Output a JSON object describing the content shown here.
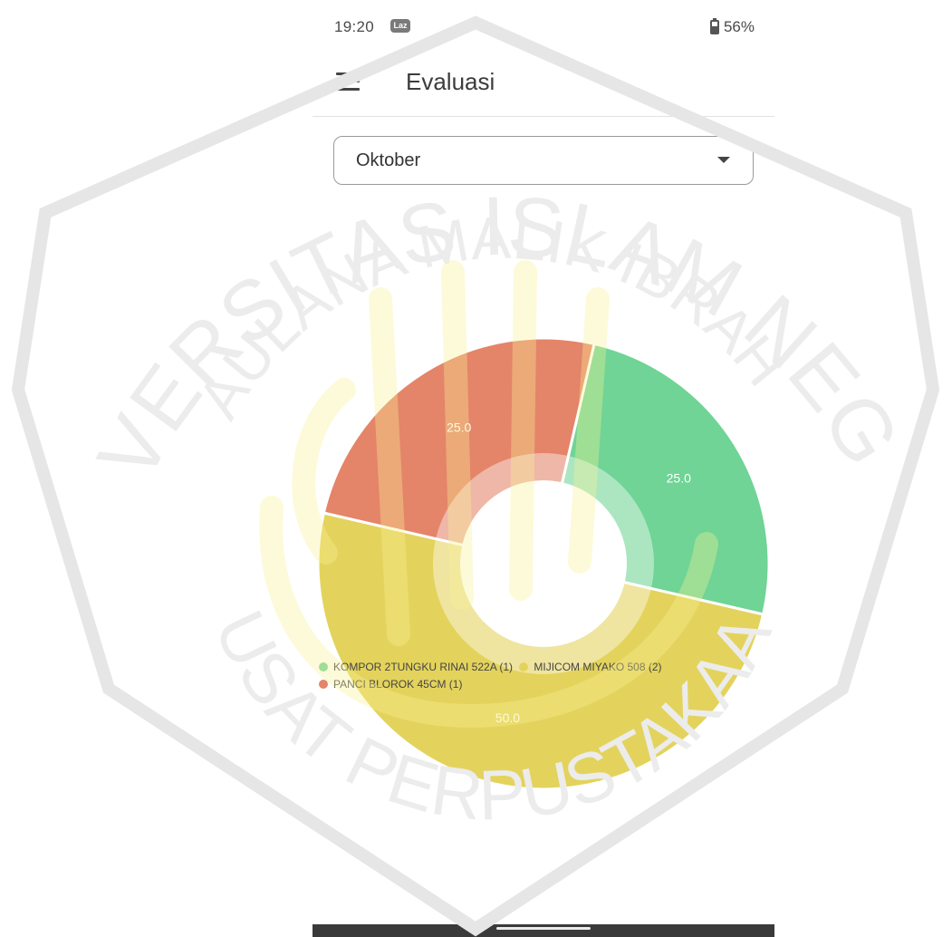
{
  "status_bar": {
    "time": "19:20",
    "badge": "Laz",
    "battery": "56%"
  },
  "app_bar": {
    "title": "Evaluasi"
  },
  "month_select": {
    "value": "Oktober"
  },
  "watermark": {
    "arc_top": "UNIVERSITAS ISLAM NEGERI",
    "arc_inner": "MAULANA MALIK IBRAHIM",
    "arc_bottom": "PUSAT PERPUSTAKAAN"
  },
  "chart_data": {
    "type": "pie",
    "donut": true,
    "labels": [
      "KOMPOR 2TUNGKU RINAI 522A  (1)",
      "MIJICOM MIYAKO 508 (2)",
      "PANCI BLOROK 45CM (1)"
    ],
    "values": [
      25.0,
      50.0,
      25.0
    ],
    "value_labels": [
      "25.0",
      "50.0",
      "25.0"
    ],
    "colors": [
      "#6fd495",
      "#e3d35c",
      "#e48469"
    ],
    "legend_position": "bottom-left"
  }
}
